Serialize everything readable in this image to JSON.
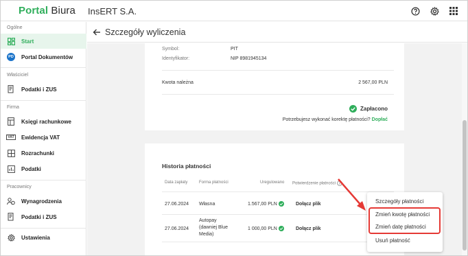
{
  "topbar": {
    "logo_part1": "Portal",
    "logo_part2": "Biura",
    "company": "InsERT S.A.",
    "icons": [
      "help-icon",
      "gear-icon",
      "apps-grid-icon"
    ]
  },
  "sidebar": {
    "sections": [
      {
        "title": "Ogólne",
        "items": [
          {
            "label": "Start",
            "icon": "dashboard-icon",
            "active": true
          },
          {
            "label": "Portal Dokumentów",
            "icon": "pd-badge-icon",
            "badge": "PD"
          }
        ]
      },
      {
        "title": "Właściciel",
        "items": [
          {
            "label": "Podatki i ZUS",
            "icon": "tax-document-icon"
          }
        ]
      },
      {
        "title": "Firma",
        "items": [
          {
            "label": "Księgi rachunkowe",
            "icon": "ledger-icon"
          },
          {
            "label": "Ewidencja VAT",
            "icon": "vat-icon",
            "badge": "VAT"
          },
          {
            "label": "Rozrachunki",
            "icon": "settlements-icon"
          },
          {
            "label": "Podatki",
            "icon": "chart-icon"
          }
        ]
      },
      {
        "title": "Pracownicy",
        "items": [
          {
            "label": "Wynagrodzenia",
            "icon": "payroll-icon"
          },
          {
            "label": "Podatki i ZUS",
            "icon": "tax-document-icon"
          }
        ]
      }
    ],
    "settings_label": "Ustawienia"
  },
  "header": {
    "title": "Szczegóły wyliczenia"
  },
  "details": {
    "symbol_label": "Symbol:",
    "symbol_value": "PIT",
    "identifier_label": "Identyfikator:",
    "identifier_value": "NIP 8981945134",
    "amount_label": "Kwota należna",
    "amount_value": "2 567,00 PLN",
    "status": "Zapłacono",
    "correction_question": "Potrzebujesz wykonać korektę płatności?",
    "correction_link": "Dopłać"
  },
  "history": {
    "title": "Historia płatności",
    "columns": [
      "Data zapłaty",
      "Forma płatności",
      "Uregulowano",
      "Potwierdzenie płatności"
    ],
    "rows": [
      {
        "date": "27.06.2024",
        "method": "Własna",
        "amount": "1.567,00 PLN",
        "confirmation": "Dołącz plik"
      },
      {
        "date": "27.06.2024",
        "method_lines": [
          "Autopay",
          "(dawniej Blue",
          "Media)"
        ],
        "amount": "1 000,00 PLN",
        "confirmation": "Dołącz plik"
      }
    ]
  },
  "context_menu": {
    "items": [
      "Szczegóły płatności",
      "Zmień kwotę płatności",
      "Zmień datę płatności",
      "Usuń płatność"
    ],
    "highlighted_items": [
      "Zmień kwotę płatności",
      "Zmień datę płatności"
    ]
  },
  "colors": {
    "brand_green": "#2fae5b",
    "highlight_red": "#e53935",
    "active_bg": "#e7f5ec"
  }
}
